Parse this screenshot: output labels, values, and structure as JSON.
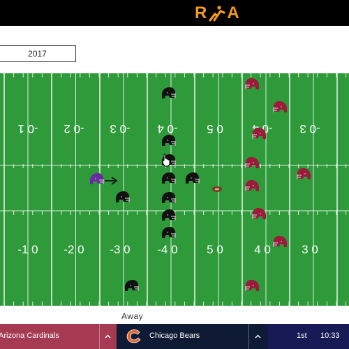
{
  "app": {
    "logo_text": "RA"
  },
  "season": {
    "value": "2017"
  },
  "field": {
    "yard_numbers_top": [
      "-0 1",
      "-0 2",
      "-0 3",
      "-0 4",
      "0 5",
      "-0 4",
      "-0 3"
    ],
    "yard_numbers_bottom": [
      "-1 0",
      "-2 0",
      "-3 0",
      "-4 0",
      "5 0",
      "4 0",
      "3 0"
    ],
    "cursor_icon": "hand-pointer-icon"
  },
  "colors": {
    "field_green": "#2e9a3a",
    "home_helmet": "#111111",
    "away_helmet": "#9b1b3a",
    "qb_helmet": "#6a2aa0",
    "team1_bg": "#a53a52",
    "team2_bg": "#0f1a35",
    "clock_bg": "#171a54"
  },
  "side_label": "Away",
  "scorebar": {
    "team1": {
      "name": "Arizona Cardinals"
    },
    "team2": {
      "name": "Chicago Bears",
      "logo_icon": "bears-c-logo-icon"
    },
    "quarter": "1st",
    "time": "10:33"
  }
}
